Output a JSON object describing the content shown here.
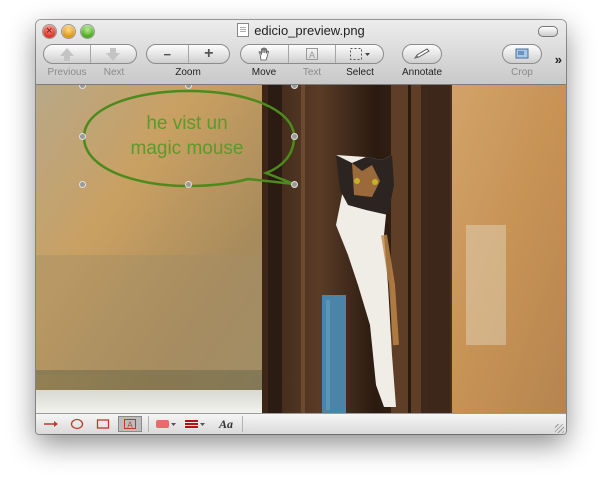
{
  "window": {
    "title": "edicio_preview.png"
  },
  "toolbar": {
    "previous_label": "Previous",
    "next_label": "Next",
    "zoom_label": "Zoom",
    "zoom_out_glyph": "−",
    "zoom_in_glyph": "+",
    "move_label": "Move",
    "text_label": "Text",
    "select_label": "Select",
    "annotate_label": "Annotate",
    "crop_label": "Crop",
    "overflow_glyph": "»"
  },
  "annotation": {
    "bubble_line1": "he vist un",
    "bubble_line2": "magic mouse",
    "text_color": "#5c9a2a",
    "stroke_color": "#4d8a1e"
  },
  "annotation_tools": {
    "arrow": "arrow-tool",
    "oval": "oval-tool",
    "rectangle": "rectangle-tool",
    "text_box": "text-box-tool",
    "color_accent": "#e86a6a",
    "line_color": "#b01515",
    "font_glyph": "Aa"
  },
  "icons": {
    "close": "close-icon",
    "minimize": "minimize-icon",
    "zoom": "zoom-window-icon",
    "document": "document-icon",
    "toolbar_toggle": "toolbar-toggle-icon",
    "previous": "arrow-up-icon",
    "next": "arrow-down-icon",
    "move": "hand-icon",
    "text": "text-tool-icon",
    "select": "marquee-icon",
    "annotate": "pencil-icon",
    "crop": "crop-icon",
    "resize": "resize-grip-icon"
  }
}
